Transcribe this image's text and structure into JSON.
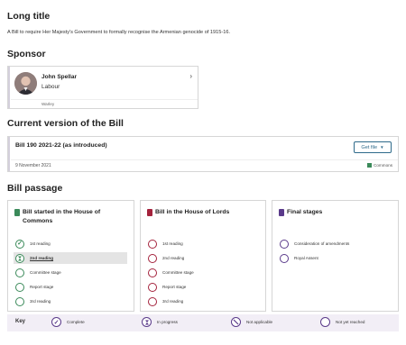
{
  "long_title": {
    "heading": "Long title",
    "text": "A Bill to require Her Majesty's Government to formally recognise the Armenian genocide of 1915-16."
  },
  "sponsor": {
    "heading": "Sponsor",
    "name": "John Spellar",
    "party": "Labour",
    "constituency": "Warley",
    "icon": "chevron-right-icon"
  },
  "current_version": {
    "heading": "Current version of the Bill",
    "title": "Bill 190 2021-22 (as introduced)",
    "button_label": "Get file",
    "date": "9 November 2021",
    "house": "Commons",
    "commons_color": "#3b8a5a"
  },
  "bill_passage": {
    "heading": "Bill passage",
    "commons": {
      "title": "Bill started in the House of Commons",
      "color": "#3b8a5a",
      "stages": [
        {
          "label": "1st reading",
          "status": "complete"
        },
        {
          "label": "2nd reading",
          "status": "in-progress"
        },
        {
          "label": "Committee stage",
          "status": "not-yet-reached"
        },
        {
          "label": "Report stage",
          "status": "not-yet-reached"
        },
        {
          "label": "3rd reading",
          "status": "not-yet-reached"
        }
      ]
    },
    "lords": {
      "title": "Bill in the House of Lords",
      "color": "#a4223c",
      "stages": [
        {
          "label": "1st reading",
          "status": "not-yet-reached"
        },
        {
          "label": "2nd reading",
          "status": "not-yet-reached"
        },
        {
          "label": "Committee stage",
          "status": "not-yet-reached"
        },
        {
          "label": "Report stage",
          "status": "not-yet-reached"
        },
        {
          "label": "3rd reading",
          "status": "not-yet-reached"
        }
      ]
    },
    "final": {
      "title": "Final stages",
      "color": "#5a3a8a",
      "stages": [
        {
          "label": "Consideration of amendments",
          "status": "not-yet-reached"
        },
        {
          "label": "Royal Assent",
          "status": "not-yet-reached"
        }
      ]
    }
  },
  "key": {
    "label": "Key",
    "items": [
      {
        "label": "Complete",
        "icon": "check-icon"
      },
      {
        "label": "In progress",
        "icon": "hourglass-icon"
      },
      {
        "label": "Not applicable",
        "icon": "not-applicable-icon"
      },
      {
        "label": "Not yet reached",
        "icon": "empty-circle-icon"
      }
    ]
  }
}
